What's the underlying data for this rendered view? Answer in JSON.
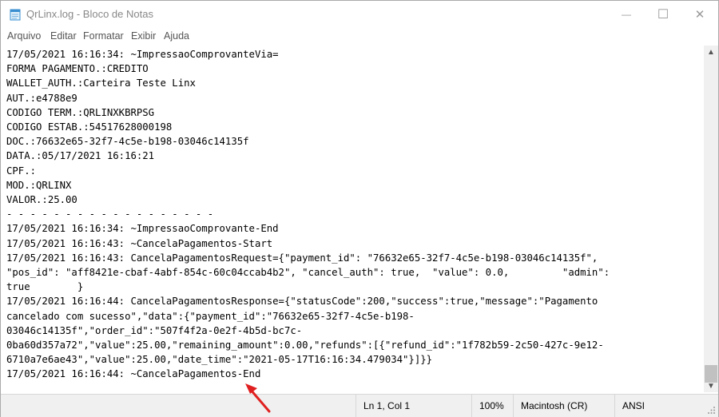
{
  "window": {
    "title": "QrLinx.log - Bloco de Notas",
    "icon": "notepad-icon",
    "controls": {
      "minimize": "—",
      "maximize": "☐",
      "close": "✕"
    }
  },
  "menu": {
    "items": [
      "Arquivo",
      "Editar",
      "Formatar",
      "Exibir",
      "Ajuda"
    ]
  },
  "editor": {
    "text": "17/05/2021 16:16:34: ~ImpressaoComprovanteVia=\nFORMA PAGAMENTO.:CREDITO\nWALLET_AUTH.:Carteira Teste Linx\nAUT.:e4788e9\nCODIGO TERM.:QRLINXKBRPSG\nCODIGO ESTAB.:54517628000198\nDOC.:76632e65-32f7-4c5e-b198-03046c14135f\nDATA.:05/17/2021 16:16:21\nCPF.:\nMOD.:QRLINX\nVALOR.:25.00\n- - - - - - - - - - - - - - - - - -\n17/05/2021 16:16:34: ~ImpressaoComprovante-End\n17/05/2021 16:16:43: ~CancelaPagamentos-Start\n17/05/2021 16:16:43: CancelaPagamentosRequest={\"payment_id\": \"76632e65-32f7-4c5e-b198-03046c14135f\",\n\"pos_id\": \"aff8421e-cbaf-4abf-854c-60c04ccab4b2\", \"cancel_auth\": true,  \"value\": 0.0,         \"admin\":\ntrue        }\n17/05/2021 16:16:44: CancelaPagamentosResponse={\"statusCode\":200,\"success\":true,\"message\":\"Pagamento\ncancelado com sucesso\",\"data\":{\"payment_id\":\"76632e65-32f7-4c5e-b198-\n03046c14135f\",\"order_id\":\"507f4f2a-0e2f-4b5d-bc7c-\n0ba60d357a72\",\"value\":25.00,\"remaining_amount\":0.00,\"refunds\":[{\"refund_id\":\"1f782b59-2c50-427c-9e12-\n6710a7e6ae43\",\"value\":25.00,\"date_time\":\"2021-05-17T16:16:34.479034\"}]}}\n17/05/2021 16:16:44: ~CancelaPagamentos-End"
  },
  "status": {
    "position": "Ln 1, Col 1",
    "zoom": "100%",
    "line_ending": "Macintosh (CR)",
    "encoding": "ANSI"
  },
  "colors": {
    "annotation_arrow": "#e02020",
    "statusbar_bg": "#f0f0f0"
  }
}
